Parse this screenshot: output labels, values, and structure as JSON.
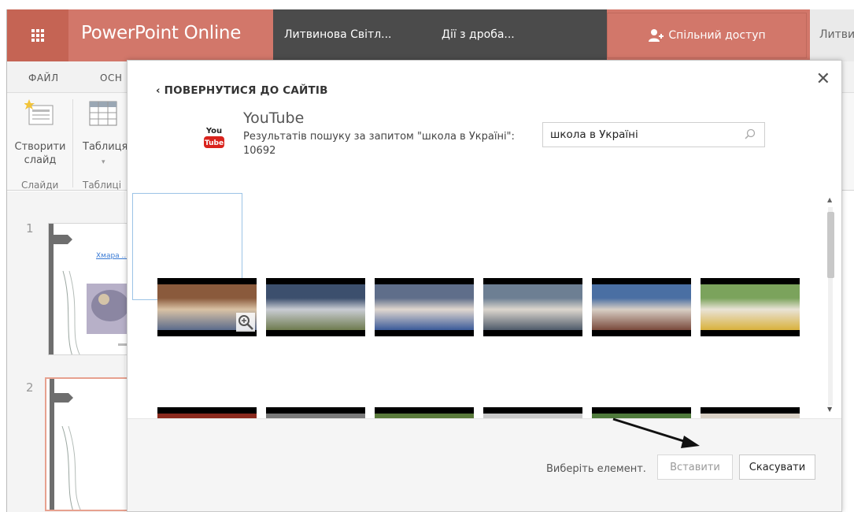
{
  "titlebar": {
    "app_name": "PowerPoint Online",
    "user_name": "Литвинова Світл...",
    "document_name": "Дії з дроба...",
    "share_label": "Спільний доступ",
    "right_user": "Литви"
  },
  "ribbon": {
    "tabs": [
      "ФАЙЛ",
      "ОСН"
    ],
    "new_slide_label": "Створити слайд",
    "table_label": "Таблиця",
    "group_slides": "Слайди",
    "group_tables": "Таблиці"
  },
  "thumbnails": {
    "items": [
      {
        "number": "1",
        "text": "Хмара ..."
      },
      {
        "number": "2"
      }
    ]
  },
  "dialog": {
    "back_label": "ПОВЕРНУТИСЯ ДО САЙТІВ",
    "provider_name": "YouTube",
    "logo_text_top": "You",
    "logo_text_bottom": "Tube",
    "results_label": "Результатів пошуку за запитом \"школа в Україні\": 10692",
    "search_value": "школа в Україні",
    "choose_hint": "Виберіть елемент.",
    "insert_label": "Вставити",
    "cancel_label": "Скасувати",
    "videos": [
      {
        "name": "video-1",
        "colors": [
          "#8a5a3c",
          "#d9c2a5",
          "#5b6b8c"
        ]
      },
      {
        "name": "video-2",
        "colors": [
          "#3c4f6d",
          "#c9ccd3",
          "#6e7b4f"
        ]
      },
      {
        "name": "video-3",
        "colors": [
          "#5f6e8a",
          "#e0d7cf",
          "#3b5b9a"
        ]
      },
      {
        "name": "video-4",
        "colors": [
          "#6d7f93",
          "#dcd6ce",
          "#4f5b6a"
        ]
      },
      {
        "name": "video-5",
        "colors": [
          "#4a6fa3",
          "#d8cfc5",
          "#7a4a3c"
        ]
      },
      {
        "name": "video-6",
        "colors": [
          "#7ba35c",
          "#e9e3d6",
          "#d9b13c"
        ]
      },
      {
        "name": "video-7",
        "colors": [
          "#8a2a1e",
          "#3a2a22",
          "#c98a3c"
        ]
      },
      {
        "name": "video-8",
        "colors": [
          "#7a7a7a",
          "#b8b8b8",
          "#4a4a4a"
        ]
      },
      {
        "name": "video-9",
        "colors": [
          "#5a7a3c",
          "#b7b09a",
          "#3a4a2a"
        ]
      },
      {
        "name": "video-10",
        "colors": [
          "#c9c9c9",
          "#8a3a2a",
          "#d7cfc5"
        ]
      },
      {
        "name": "video-11",
        "colors": [
          "#4f7a3c",
          "#8aa35c",
          "#3a4f6e"
        ]
      },
      {
        "name": "video-12",
        "colors": [
          "#d8d0c5",
          "#7a5a8a",
          "#b8a58c"
        ]
      }
    ]
  },
  "colors": {
    "brand": "#d2776a",
    "dark_bar": "#4b4b4b"
  }
}
